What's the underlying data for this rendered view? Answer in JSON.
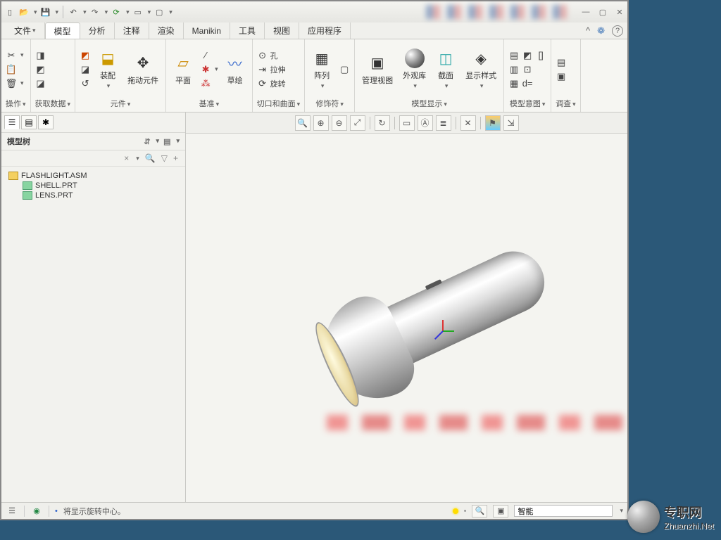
{
  "quick_access": [
    "new",
    "open",
    "save",
    "save-dd",
    "undo",
    "undo-dd",
    "redo",
    "redo-dd",
    "regen",
    "regen-dd",
    "windows",
    "close"
  ],
  "menu_tabs": [
    "文件",
    "模型",
    "分析",
    "注释",
    "渲染",
    "Manikin",
    "工具",
    "视图",
    "应用程序"
  ],
  "active_tab": 1,
  "ribbon_groups": [
    {
      "label": "操作",
      "items": []
    },
    {
      "label": "获取数据",
      "items": []
    },
    {
      "label": "元件",
      "big": [
        {
          "icon": "⚙",
          "text": "装配"
        },
        {
          "icon": "✥",
          "text": "拖动元件"
        }
      ],
      "side": [
        "◩",
        "◪",
        "↺"
      ]
    },
    {
      "label": "基准",
      "big": [
        {
          "icon": "▱",
          "text": "平面"
        },
        {
          "icon": "〰",
          "text": "草绘"
        }
      ],
      "side": [
        "✱",
        "✶",
        "⁂",
        "⌖"
      ]
    },
    {
      "label": "切口和曲面",
      "items": [
        {
          "icon": "⊙",
          "text": "孔"
        },
        {
          "icon": "⇥",
          "text": "拉伸"
        },
        {
          "icon": "⟳",
          "text": "旋转"
        }
      ]
    },
    {
      "label": "修饰符",
      "big": [
        {
          "icon": "▦",
          "text": "阵列"
        }
      ],
      "side": [
        "▢"
      ]
    },
    {
      "label": "模型显示",
      "big": [
        {
          "icon": "▣",
          "text": "管理视图"
        },
        {
          "icon": "●",
          "text": "外观库"
        },
        {
          "icon": "◫",
          "text": "截面"
        },
        {
          "icon": "◈",
          "text": "显示样式"
        }
      ]
    },
    {
      "label": "模型意图",
      "side": [
        "▤",
        "◩",
        "▥",
        "⊡",
        "[]",
        "▦",
        "d="
      ]
    },
    {
      "label": "调查",
      "side": [
        "▤",
        "▣"
      ]
    }
  ],
  "view_toolbar": [
    "zoom-in",
    "zoom-all",
    "zoom-out",
    "zoom-sel",
    "sep",
    "reorient",
    "sep",
    "saved-view",
    "annot",
    "layers",
    "sep",
    "comp",
    "sep",
    "tree-colors",
    "explode"
  ],
  "tree": {
    "title": "模型树",
    "root": "FLASHLIGHT.ASM",
    "children": [
      "SHELL.PRT",
      "LENS.PRT"
    ]
  },
  "status": {
    "msg": "将显示旋转中心。",
    "filter": "智能"
  },
  "watermark": {
    "line1": "专职网",
    "line2": "Zhuanzhi.Net"
  }
}
